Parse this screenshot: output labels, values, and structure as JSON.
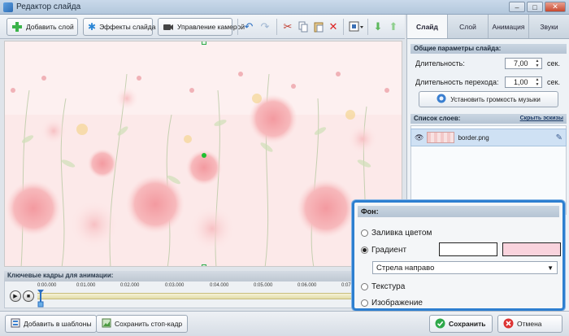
{
  "window": {
    "title": "Редактор слайда",
    "controls": [
      "–",
      "□",
      "✕"
    ]
  },
  "toolbar": {
    "add_layer": "Добавить слой",
    "slide_effects": "Эффекты слайда",
    "camera_control": "Управление камерой"
  },
  "tabs": [
    {
      "label": "Слайд",
      "active": true
    },
    {
      "label": "Слой",
      "active": false
    },
    {
      "label": "Анимация",
      "active": false
    },
    {
      "label": "Звуки",
      "active": false
    }
  ],
  "slide_params": {
    "heading": "Общие параметры слайда:",
    "duration_label": "Длительность:",
    "duration_value": "7,00",
    "duration_unit": "сек.",
    "transition_label": "Длительность перехода:",
    "transition_value": "1,00",
    "transition_unit": "сек.",
    "volume_button": "Установить громкость музыки"
  },
  "layers": {
    "heading": "Список слоев:",
    "hide_all": "Скрыть эскизы",
    "items": [
      {
        "name": "border.png"
      }
    ]
  },
  "timeline": {
    "heading": "Ключевые кадры для анимации:",
    "ticks": [
      "0:00.000",
      "0:01.000",
      "0:02.000",
      "0:03.000",
      "0:04.000",
      "0:05.000",
      "0:06.000",
      "0:07.000"
    ]
  },
  "background_popup": {
    "heading": "Фон:",
    "options": [
      {
        "label": "Заливка цветом",
        "selected": false
      },
      {
        "label": "Градиент",
        "selected": true
      },
      {
        "label": "Текстура",
        "selected": false
      },
      {
        "label": "Изображение",
        "selected": false
      }
    ],
    "gradient_color_1": "#ffffff",
    "gradient_color_2": "#f9d3dd",
    "direction": "Стрела направо"
  },
  "bottom": {
    "add_to_templates": "Добавить в шаблоны",
    "save_still": "Сохранить стоп-кадр",
    "save": "Сохранить",
    "cancel": "Отмена"
  },
  "colors": {
    "accent": "#2d7fd0",
    "canvas_bg": "#fbe7e7"
  }
}
